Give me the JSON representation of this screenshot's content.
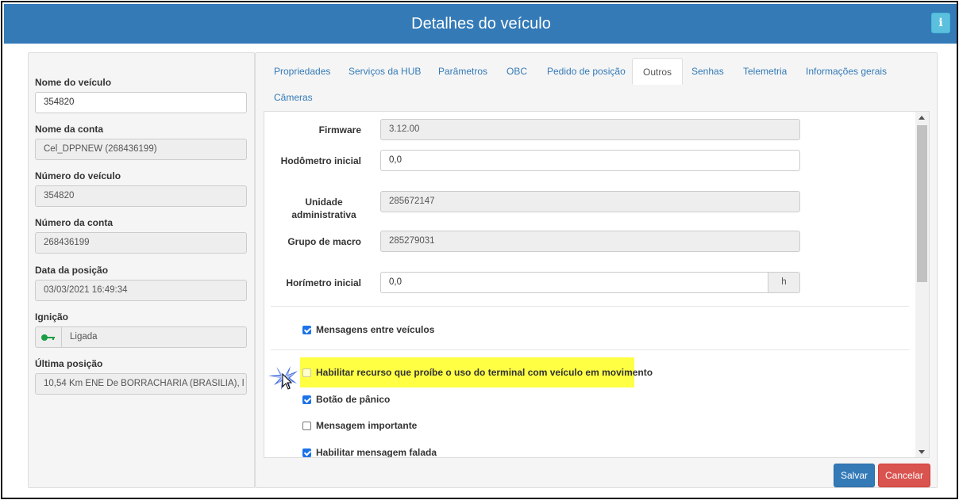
{
  "header": {
    "title": "Detalhes do veículo",
    "info_icon": "i"
  },
  "left": {
    "vehicle_name_label": "Nome do veículo",
    "vehicle_name_value": "354820",
    "account_name_label": "Nome da conta",
    "account_name_value": "Cel_DPPNEW (268436199)",
    "vehicle_number_label": "Número do veículo",
    "vehicle_number_value": "354820",
    "account_number_label": "Número da conta",
    "account_number_value": "268436199",
    "position_date_label": "Data da posição",
    "position_date_value": "03/03/2021 16:49:34",
    "ignition_label": "Ignição",
    "ignition_value": "Ligada",
    "last_position_label": "Última posição",
    "last_position_value": "10,54 Km ENE De BORRACHARIA (BRASILIA), l"
  },
  "tabs": [
    {
      "label": "Propriedades",
      "active": false
    },
    {
      "label": "Serviços da HUB",
      "active": false
    },
    {
      "label": "Parâmetros",
      "active": false
    },
    {
      "label": "OBC",
      "active": false
    },
    {
      "label": "Pedido de posição",
      "active": false
    },
    {
      "label": "Outros",
      "active": true
    },
    {
      "label": "Senhas",
      "active": false
    },
    {
      "label": "Telemetria",
      "active": false
    },
    {
      "label": "Informações gerais",
      "active": false
    },
    {
      "label": "Câmeras",
      "active": false
    }
  ],
  "form": {
    "firmware_label": "Firmware",
    "firmware_value": "3.12.00",
    "odometer_label": "Hodômetro inicial",
    "odometer_value": "0,0",
    "admin_unit_label_1": "Unidade",
    "admin_unit_label_2": "administrativa",
    "admin_unit_value": "285672147",
    "macro_group_label": "Grupo de macro",
    "macro_group_value": "285279031",
    "hourmeter_label": "Horímetro inicial",
    "hourmeter_value": "0,0",
    "hourmeter_unit": "h"
  },
  "checkboxes": [
    {
      "label": "Mensagens entre veículos",
      "checked": true
    },
    {
      "label": "Habilitar recurso que proíbe o uso do terminal com veículo em movimento",
      "checked": false,
      "highlighted": true
    },
    {
      "label": "Botão de pânico",
      "checked": true
    },
    {
      "label": "Mensagem importante",
      "checked": false
    },
    {
      "label": "Habilitar mensagem falada",
      "checked": true
    }
  ],
  "buttons": {
    "save": "Salvar",
    "cancel": "Cancelar"
  },
  "colors": {
    "header": "#337ab7",
    "highlight": "#ffff44",
    "save": "#337ab7",
    "cancel": "#d9534f",
    "ignition_key": "#1a9e45"
  }
}
